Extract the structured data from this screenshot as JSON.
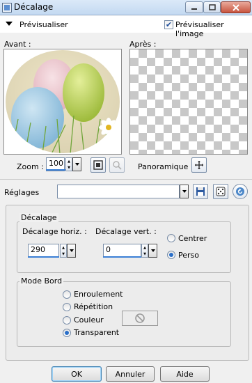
{
  "window": {
    "title": "Décalage"
  },
  "preview": {
    "toggle_label": "Prévisualiser",
    "image_check_label": "Prévisualiser l'image",
    "image_checked": true,
    "before_label": "Avant :",
    "after_label": "Après :"
  },
  "zoom": {
    "label": "Zoom :",
    "value": "100",
    "pan_label": "Panoramique :"
  },
  "presets": {
    "label": "Réglages",
    "value": ""
  },
  "offset": {
    "title": "Décalage",
    "horizontal_label": "Décalage horiz. :",
    "horizontal_value": "290",
    "vertical_label": "Décalage vert. :",
    "vertical_value": "0",
    "center_label": "Centrer",
    "custom_label": "Perso",
    "selected": "custom"
  },
  "edge_mode": {
    "title": "Mode Bord",
    "options": [
      "Enroulement",
      "Répétition",
      "Couleur",
      "Transparent"
    ],
    "selected": "Transparent"
  },
  "buttons": {
    "ok": "OK",
    "cancel": "Annuler",
    "help": "Aide"
  },
  "icons": {
    "app": "offset-app-icon",
    "fit": "fit-window-icon",
    "actual": "zoom-actual-icon",
    "pan": "pan-crosshair-icon",
    "save": "save-disk-icon",
    "random": "dice-icon",
    "reset": "reset-arrow-icon",
    "no_color": "no-color-icon"
  },
  "colors": {
    "accent": "#3a7fd6",
    "radio_selected": "#2a6fc9"
  }
}
